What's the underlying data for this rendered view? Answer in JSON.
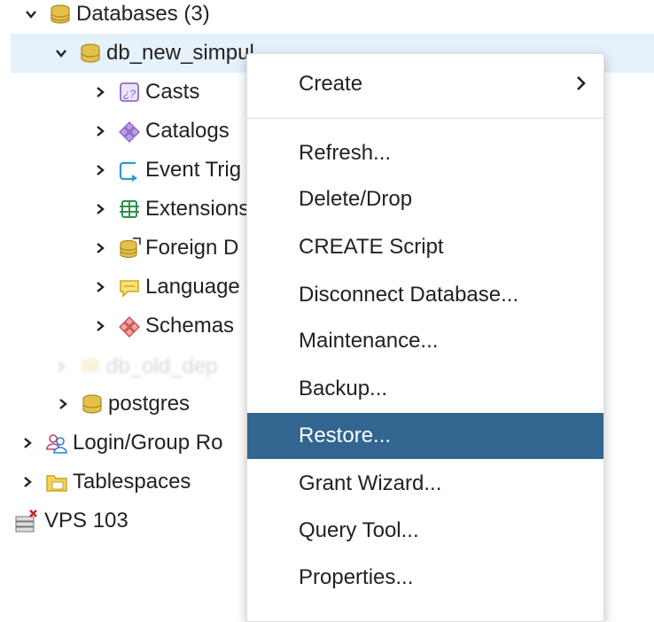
{
  "tree": {
    "databases": "Databases (3)",
    "db_selected": "db_new_simpul",
    "children": [
      "Casts",
      "Catalogs",
      "Event Trig",
      "Extensions",
      "Foreign D",
      "Language",
      "Schemas"
    ],
    "blurred_db": "db_old_dep",
    "postgres": "postgres",
    "login_roles": "Login/Group Ro",
    "tablespaces": "Tablespaces",
    "server": "VPS 103"
  },
  "context_menu": {
    "create": "Create",
    "items": [
      "Refresh...",
      "Delete/Drop",
      "CREATE Script",
      "Disconnect Database...",
      "Maintenance...",
      "Backup...",
      "Restore...",
      "Grant Wizard...",
      "Query Tool...",
      "Properties..."
    ],
    "active": "Restore..."
  },
  "colors": {
    "selected_row": "#e5f1fb",
    "menu_active_bg": "#326690",
    "db_icon": "#d9b63a"
  },
  "icons": {
    "databases": "database-stack-icon",
    "db": "database-icon",
    "casts": "casts-icon",
    "catalogs": "catalog-icon",
    "event_triggers": "event-trigger-icon",
    "extensions": "extension-icon",
    "foreign": "foreign-data-wrapper-icon",
    "languages": "language-icon",
    "schemas": "schema-icon",
    "login": "login-group-roles-icon",
    "tablespaces": "tablespace-folder-icon",
    "server": "server-disconnected-icon"
  }
}
